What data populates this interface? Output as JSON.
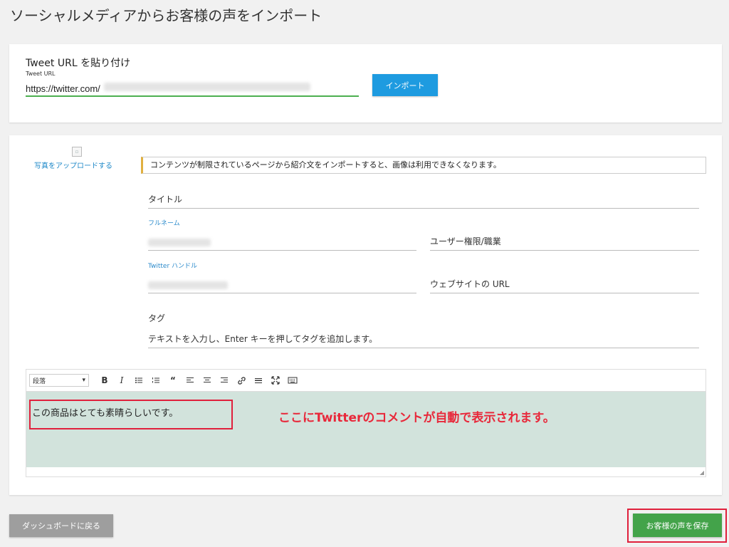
{
  "page_title": "ソーシャルメディアからお客様の声をインポート",
  "import_card": {
    "heading": "Tweet URL を貼り付け",
    "field_label": "Tweet URL",
    "url_value": "https://twitter.com/",
    "import_button": "インポート"
  },
  "details_card": {
    "upload_link": "写真をアップロードする",
    "notice": "コンテンツが制限されているページから紹介文をインポートすると、画像は利用できなくなります。",
    "title_placeholder": "タイトル",
    "fullname_label": "フルネーム",
    "role_placeholder": "ユーザー権限/職業",
    "twitter_label": "Twitter ハンドル",
    "website_placeholder": "ウェブサイトの URL",
    "tags_label": "タグ",
    "tags_placeholder": "テキストを入力し、Enter キーを押してタグを追加します。"
  },
  "editor": {
    "heading_select": "段落",
    "content": "この商品はとても素晴らしいです。",
    "annotation": "ここにTwitterのコメントが自動で表示されます。"
  },
  "footer": {
    "back_button": "ダッシュボードに戻る",
    "save_button": "お客様の声を保存"
  },
  "colors": {
    "import_button": "#1e9be0",
    "save_button": "#43a34a",
    "back_button": "#9e9e9e",
    "annotation": "#e8283a",
    "editor_background": "#d2e3dc",
    "input_underline": "#4caf50"
  }
}
